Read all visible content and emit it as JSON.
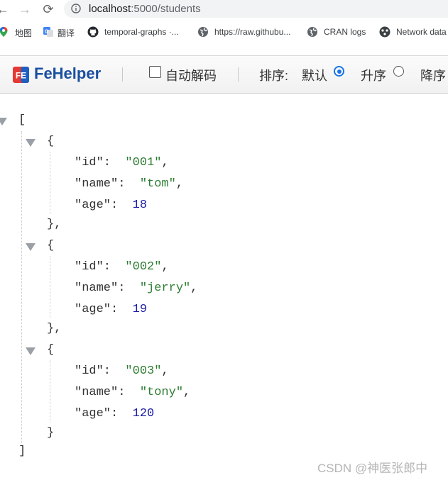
{
  "browser": {
    "url_host": "localhost",
    "url_path": ":5000/students",
    "bookmarks": [
      {
        "label": "地图",
        "icon": "maps-pin-icon"
      },
      {
        "label": "翻译",
        "icon": "translate-icon"
      },
      {
        "label": "temporal-graphs ·...",
        "icon": "github-icon"
      },
      {
        "label": "https://raw.githubu...",
        "icon": "globe-icon"
      },
      {
        "label": "CRAN logs",
        "icon": "globe-icon"
      },
      {
        "label": "Network data",
        "icon": "network-icon"
      }
    ]
  },
  "toolbar": {
    "title": "FeHelper",
    "logo_text": "FE",
    "auto_decode_label": "自动解码",
    "auto_decode_checked": false,
    "sort_label": "排序:",
    "sort_options": [
      {
        "label": "默认",
        "selected": true
      },
      {
        "label": "升序",
        "selected": false
      },
      {
        "label": "降序",
        "selected": false
      }
    ]
  },
  "json_view": {
    "open_bracket": "[",
    "close_bracket": "]",
    "records": [
      {
        "id": "001",
        "name": "tom",
        "age": 18
      },
      {
        "id": "002",
        "name": "jerry",
        "age": 19
      },
      {
        "id": "003",
        "name": "tony",
        "age": 120
      }
    ]
  },
  "watermark": "CSDN @神医张郎中",
  "colors": {
    "string": "#2e7d32",
    "number": "#1a1aa6",
    "brand": "#1a4fa0",
    "radio_selected": "#1a73e8"
  }
}
